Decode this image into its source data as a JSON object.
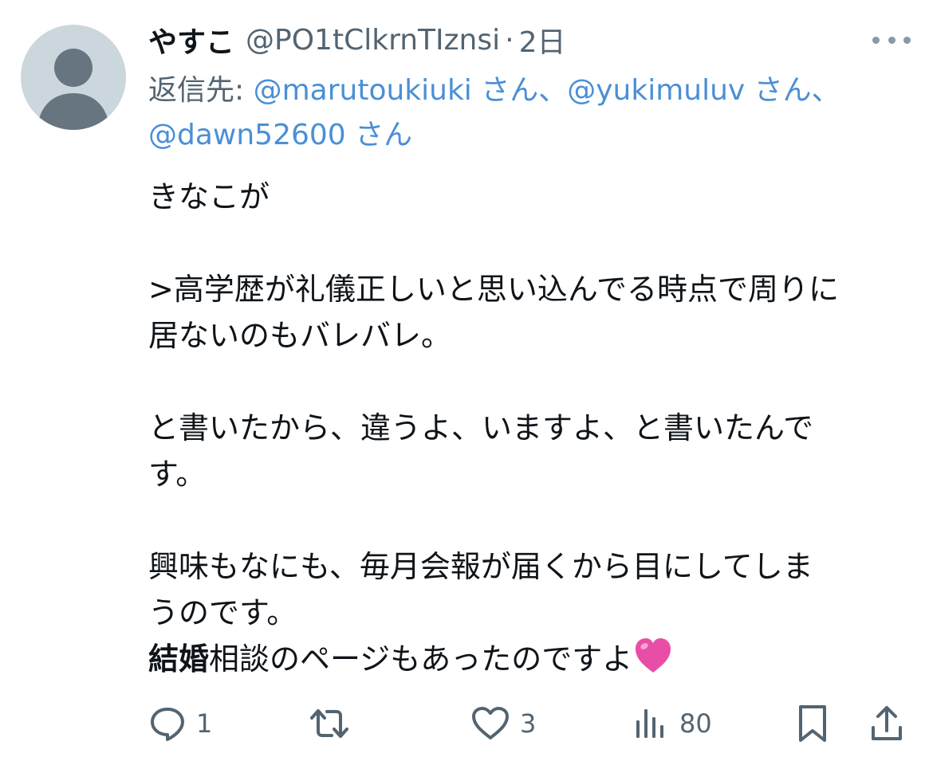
{
  "tweet": {
    "display_name": "やすこ",
    "handle": "@PO1tClkrnTIznsi",
    "separator": "·",
    "time": "2日",
    "reply": {
      "prefix": "返信先: ",
      "mentions": [
        {
          "handle": "@marutoukiuki",
          "suffix": " さん、"
        },
        {
          "handle": "@yukimuluv",
          "suffix": " さん、"
        },
        {
          "handle": "@dawn52600",
          "suffix": " さん"
        }
      ]
    },
    "body": {
      "line1": "きなこが",
      "quote_line1": ">高学歴が礼儀正しいと思い込んでる時点で周りに",
      "quote_line2": "居ないのもバレバレ。",
      "para2_line1": "と書いたから、違うよ、いますよ、と書いたんで",
      "para2_line2": "す。",
      "para3_line1": "興味もなにも、毎月会報が届くから目にしてしま",
      "para3_line2": "うのです。",
      "last_bold": "結婚",
      "last_rest": "相談のページもあったのですよ"
    },
    "actions": {
      "reply_count": "1",
      "retweet_count": "",
      "like_count": "3",
      "views_count": "80"
    }
  },
  "icons": {
    "avatar": "default-avatar-icon",
    "more": "more-dots-icon",
    "heart_emoji": "pink-heart-emoji",
    "reply": "reply-bubble-icon",
    "retweet": "retweet-icon",
    "like": "heart-outline-icon",
    "views": "views-bars-icon",
    "bookmark": "bookmark-icon",
    "share": "share-icon"
  },
  "colors": {
    "text": "#0f1419",
    "secondary": "#536471",
    "link": "#4a8fd6",
    "icon": "#536471",
    "avatar_bg": "#ccd6dd",
    "avatar_fg": "#66757f",
    "heart_emoji": "#e84ea6"
  }
}
